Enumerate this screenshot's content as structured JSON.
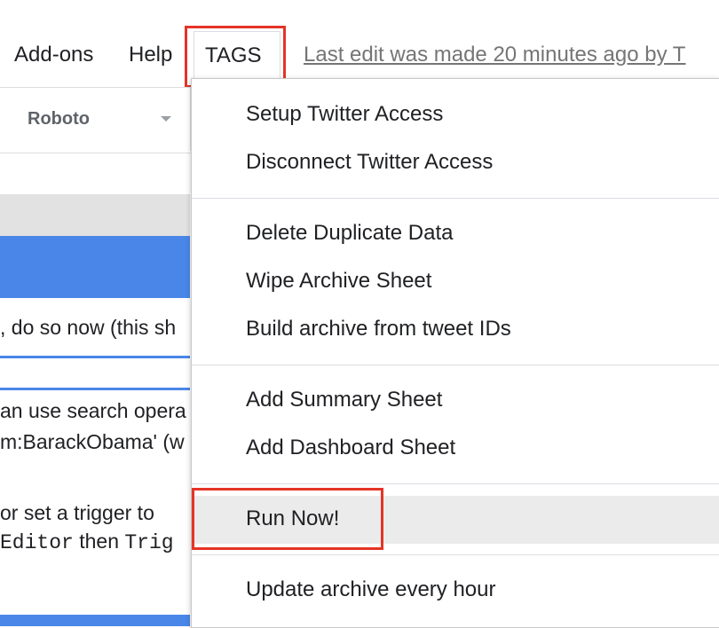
{
  "menubar": {
    "items": [
      {
        "label": "Add-ons"
      },
      {
        "label": "Help"
      },
      {
        "label": "TAGS"
      }
    ],
    "last_edit": "Last edit was made 20 minutes ago by T"
  },
  "toolbar": {
    "font": "Roboto"
  },
  "sheet": {
    "line1": ", do so now (this sh",
    "line2": "an use search opera",
    "line3": "m:BarackObama' (w",
    "line4": " or set a trigger to",
    "line5_mono1": " Editor",
    "line5_text": " then ",
    "line5_mono2": "Trig"
  },
  "tags_menu": {
    "groups": [
      [
        "Setup Twitter Access",
        "Disconnect Twitter Access"
      ],
      [
        "Delete Duplicate Data",
        "Wipe Archive Sheet",
        "Build archive from tweet IDs"
      ],
      [
        "Add Summary Sheet",
        "Add Dashboard Sheet"
      ],
      [
        "Run Now!"
      ],
      [
        "Update archive every hour"
      ]
    ]
  }
}
